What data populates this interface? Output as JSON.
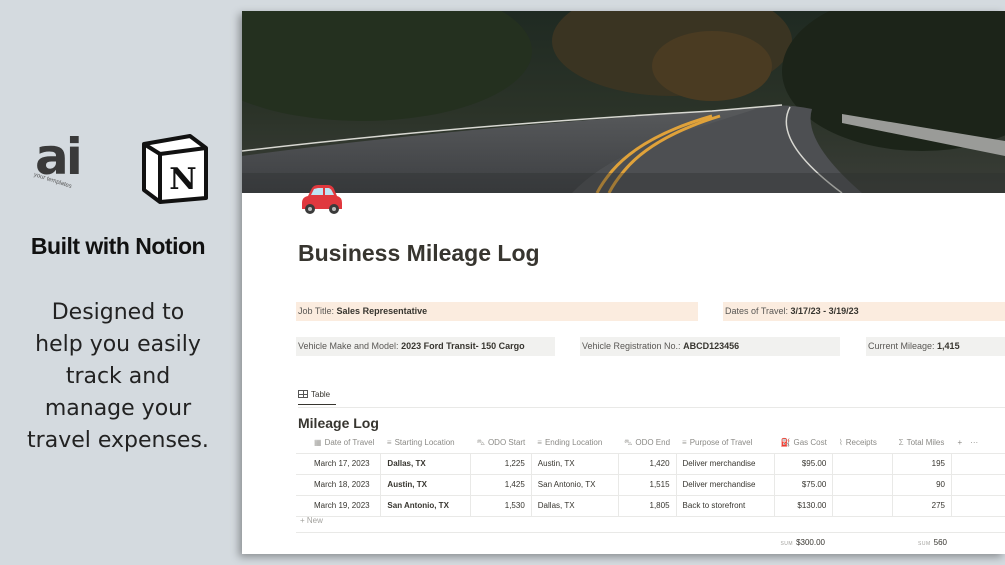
{
  "promo": {
    "logo_text": "ai",
    "logo_tagline": "your templates",
    "notion_letter": "N",
    "headline": "Built with Notion",
    "tagline_lines": [
      "Designed to",
      "help you easily",
      "track and",
      "manage your",
      "travel expenses."
    ]
  },
  "page": {
    "icon": "red-car-icon",
    "title": "Business Mileage Log",
    "properties": {
      "job_title": {
        "label": "Job Title:",
        "value": "Sales Representative"
      },
      "dates_of_travel": {
        "label": "Dates of Travel:",
        "value": "3/17/23 - 3/19/23"
      },
      "vehicle": {
        "label": "Vehicle Make and Model:",
        "value": "2023 Ford Transit- 150 Cargo"
      },
      "registration": {
        "label": "Vehicle Registration No.:",
        "value": "ABCD123456"
      },
      "mileage": {
        "label": "Current Mileage:",
        "value": "1,415"
      }
    },
    "view_tab": "Table",
    "database_title": "Mileage Log",
    "columns": [
      {
        "label": "Date of Travel",
        "icon": "calendar-icon",
        "glyph": "▦"
      },
      {
        "label": "Starting Location",
        "icon": "text-icon",
        "glyph": "≡"
      },
      {
        "label": "ODO Start",
        "icon": "car-icon",
        "glyph": "⛍"
      },
      {
        "label": "Ending Location",
        "icon": "text-icon",
        "glyph": "≡"
      },
      {
        "label": "ODO End",
        "icon": "car-icon",
        "glyph": "⛍"
      },
      {
        "label": "Purpose of Travel",
        "icon": "text-icon",
        "glyph": "≡"
      },
      {
        "label": "Gas Cost",
        "icon": "gas-pump-icon",
        "glyph": "⛽"
      },
      {
        "label": "Receipts",
        "icon": "paperclip-icon",
        "glyph": "⌇"
      },
      {
        "label": "Total Miles",
        "icon": "formula-icon",
        "glyph": "Σ"
      }
    ],
    "add_column": "+",
    "more_options": "···",
    "rows": [
      {
        "date": "March 17, 2023",
        "start": "Dallas, TX",
        "odo_start": "1,225",
        "end": "Austin, TX",
        "odo_end": "1,420",
        "purpose": "Deliver merchandise",
        "gas": "$95.00",
        "receipts": "",
        "total": "195"
      },
      {
        "date": "March 18, 2023",
        "start": "Austin, TX",
        "odo_start": "1,425",
        "end": "San Antonio, TX",
        "odo_end": "1,515",
        "purpose": "Deliver merchandise",
        "gas": "$75.00",
        "receipts": "",
        "total": "90"
      },
      {
        "date": "March 19, 2023",
        "start": "San Antonio, TX",
        "odo_start": "1,530",
        "end": "Dallas, TX",
        "odo_end": "1,805",
        "purpose": "Back to storefront",
        "gas": "$130.00",
        "receipts": "",
        "total": "275"
      }
    ],
    "new_row": "+ New",
    "sums": {
      "label": "SUM",
      "gas": "$300.00",
      "total_miles": "560"
    }
  },
  "colors": {
    "peach_property": "#fbecdf",
    "gray_property": "#f1f1ef",
    "background": "#d4dadf",
    "car_red": "#e0383e"
  }
}
